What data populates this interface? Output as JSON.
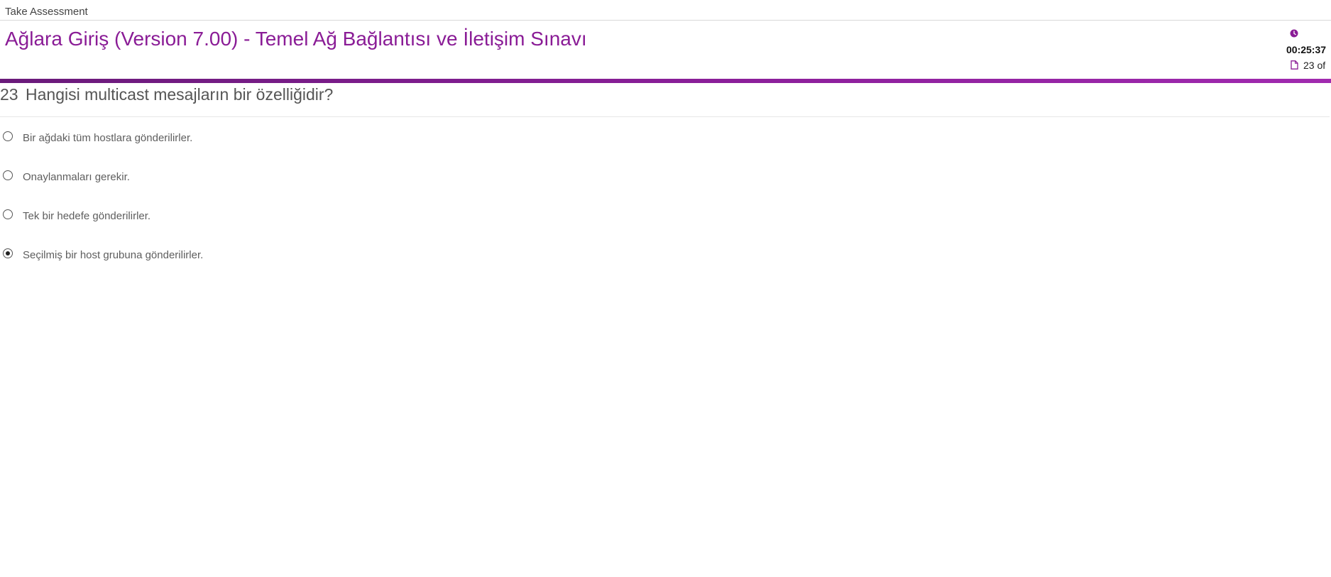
{
  "topbar": {
    "title": "Take Assessment"
  },
  "header": {
    "exam_title": "Ağlara Giriş (Version 7.00) - Temel Ağ Bağlantısı ve İletişim Sınavı",
    "timer": "00:25:37",
    "timer_icon": "clock-icon",
    "progress": "23 of",
    "progress_icon": "document-icon"
  },
  "colors": {
    "accent": "#8a1c96",
    "text": "#555555"
  },
  "question": {
    "number": "23",
    "text": "Hangisi multicast mesajların bir özelliğidir?"
  },
  "answers": [
    {
      "label": "Bir ağdaki tüm hostlara gönderilirler.",
      "selected": false
    },
    {
      "label": "Onaylanmaları gerekir.",
      "selected": false
    },
    {
      "label": "Tek bir hedefe gönderilirler.",
      "selected": false
    },
    {
      "label": "Seçilmiş bir host grubuna gönderilirler.",
      "selected": true
    }
  ]
}
